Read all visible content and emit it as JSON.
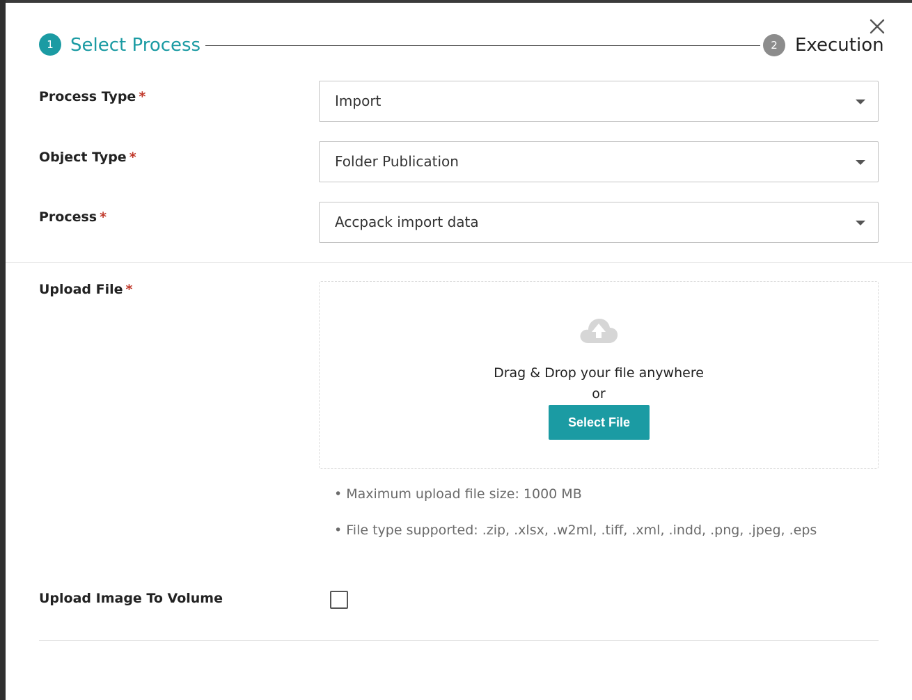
{
  "stepper": {
    "step1": {
      "number": "1",
      "label": "Select Process"
    },
    "step2": {
      "number": "2",
      "label": "Execution"
    }
  },
  "form": {
    "process_type": {
      "label": "Process Type",
      "required": "*",
      "value": "Import"
    },
    "object_type": {
      "label": "Object Type",
      "required": "*",
      "value": "Folder Publication"
    },
    "process": {
      "label": "Process",
      "required": "*",
      "value": "Accpack import data"
    },
    "upload_file": {
      "label": "Upload File",
      "required": "*",
      "drop_text": "Drag & Drop your file anywhere",
      "or_text": "or",
      "button_label": "Select File",
      "hints": [
        "• Maximum upload file size: 1000 MB",
        "• File type supported: .zip, .xlsx, .w2ml, .tiff, .xml, .indd, .png, .jpeg, .eps"
      ]
    },
    "upload_image_to_volume": {
      "label": "Upload Image To Volume",
      "checked": false
    }
  },
  "icons": {
    "close": "close-icon",
    "upload": "cloud-upload-icon",
    "dropdown": "chevron-down-icon"
  },
  "colors": {
    "accent": "#1b9ba3",
    "required": "#c0392b",
    "inactive_step": "#8c8c8c"
  }
}
